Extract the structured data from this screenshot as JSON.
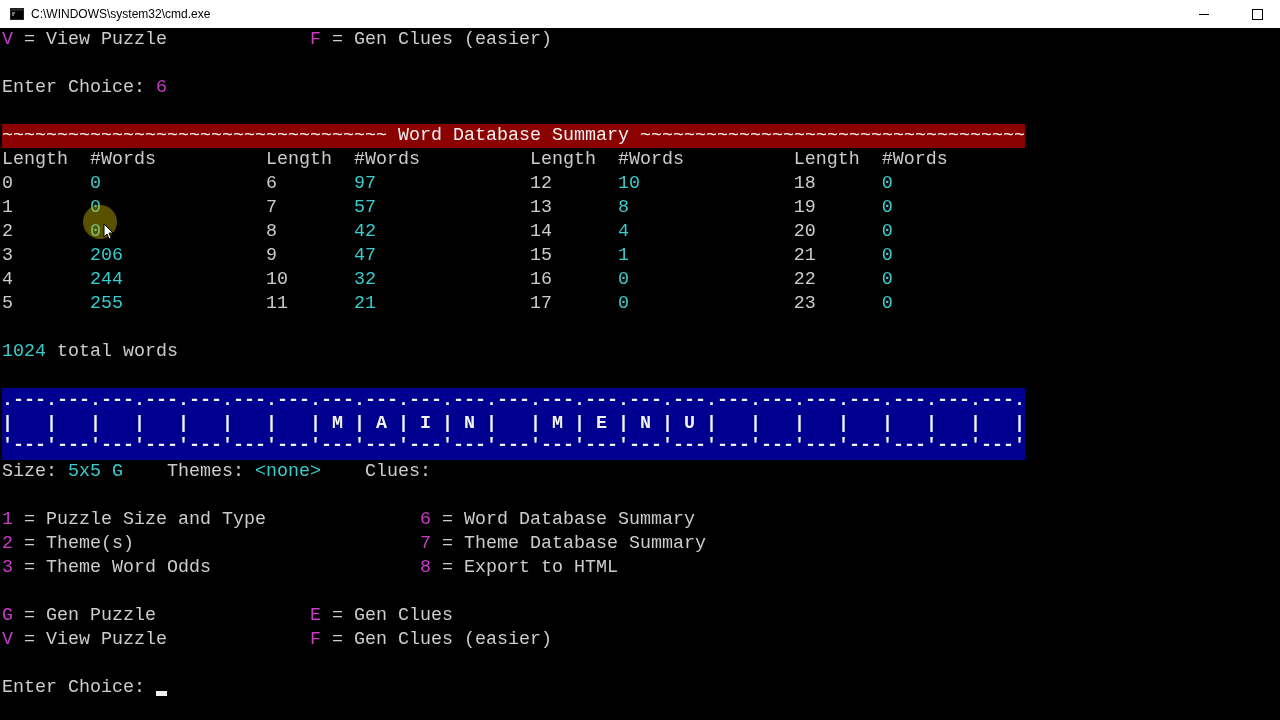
{
  "window": {
    "title": "C:\\WINDOWS\\system32\\cmd.exe"
  },
  "previous_output": {
    "actions": [
      {
        "key": "V",
        "label": "= View Puzzle"
      },
      {
        "key": "F",
        "label": "= Gen Clues (easier)"
      }
    ],
    "prompt": "Enter Choice:",
    "choice": "6"
  },
  "summary": {
    "banner": "~~~~~~~~~~~~~~~~~~~~~~~~~~~~~~~~~~~ Word Database Summary ~~~~~~~~~~~~~~~~~~~~~~~~~~~~~~~~~~~",
    "groups": [
      {
        "length_header": "Length",
        "words_header": "#Words",
        "rows": [
          {
            "length": "0",
            "words": "0"
          },
          {
            "length": "1",
            "words": "0"
          },
          {
            "length": "2",
            "words": "0"
          },
          {
            "length": "3",
            "words": "206"
          },
          {
            "length": "4",
            "words": "244"
          },
          {
            "length": "5",
            "words": "255"
          }
        ]
      },
      {
        "length_header": "Length",
        "words_header": "#Words",
        "rows": [
          {
            "length": "6",
            "words": "97"
          },
          {
            "length": "7",
            "words": "57"
          },
          {
            "length": "8",
            "words": "42"
          },
          {
            "length": "9",
            "words": "47"
          },
          {
            "length": "10",
            "words": "32"
          },
          {
            "length": "11",
            "words": "21"
          }
        ]
      },
      {
        "length_header": "Length",
        "words_header": "#Words",
        "rows": [
          {
            "length": "12",
            "words": "10"
          },
          {
            "length": "13",
            "words": "8"
          },
          {
            "length": "14",
            "words": "4"
          },
          {
            "length": "15",
            "words": "1"
          },
          {
            "length": "16",
            "words": "0"
          },
          {
            "length": "17",
            "words": "0"
          }
        ]
      },
      {
        "length_header": "Length",
        "words_header": "#Words",
        "rows": [
          {
            "length": "18",
            "words": "0"
          },
          {
            "length": "19",
            "words": "0"
          },
          {
            "length": "20",
            "words": "0"
          },
          {
            "length": "21",
            "words": "0"
          },
          {
            "length": "22",
            "words": "0"
          },
          {
            "length": "23",
            "words": "0"
          }
        ]
      }
    ],
    "total": {
      "count": "1024",
      "label": "total words"
    }
  },
  "main_menu": {
    "lines": [
      ".---.---.---.---.---.---.---.---.---.---.---.---.---.---.---.---.---.---.---.---.---.---.---.",
      "|   |   |   |   |   |   |   | M | A | I | N |   | M | E | N | U |   |   |   |   |   |   |   |",
      "'---'---'---'---'---'---'---'---'---'---'---'---'---'---'---'---'---'---'---'---'---'---'---'"
    ]
  },
  "status": {
    "size_label": "Size:",
    "size": "5x5 G",
    "themes_label": "Themes:",
    "themes": "<none>",
    "clues_label": "Clues:"
  },
  "options_left": [
    {
      "key": "1",
      "label": "= Puzzle Size and Type"
    },
    {
      "key": "2",
      "label": "= Theme(s)"
    },
    {
      "key": "3",
      "label": "= Theme Word Odds"
    }
  ],
  "options_right": [
    {
      "key": "6",
      "label": "= Word Database Summary"
    },
    {
      "key": "7",
      "label": "= Theme Database Summary"
    },
    {
      "key": "8",
      "label": "= Export to HTML"
    }
  ],
  "actions": [
    [
      {
        "key": "G",
        "label": "= Gen Puzzle"
      },
      {
        "key": "E",
        "label": "= Gen Clues"
      }
    ],
    [
      {
        "key": "V",
        "label": "= View Puzzle"
      },
      {
        "key": "F",
        "label": "= Gen Clues (easier)"
      }
    ]
  ],
  "prompt": {
    "text": "Enter Choice:"
  }
}
